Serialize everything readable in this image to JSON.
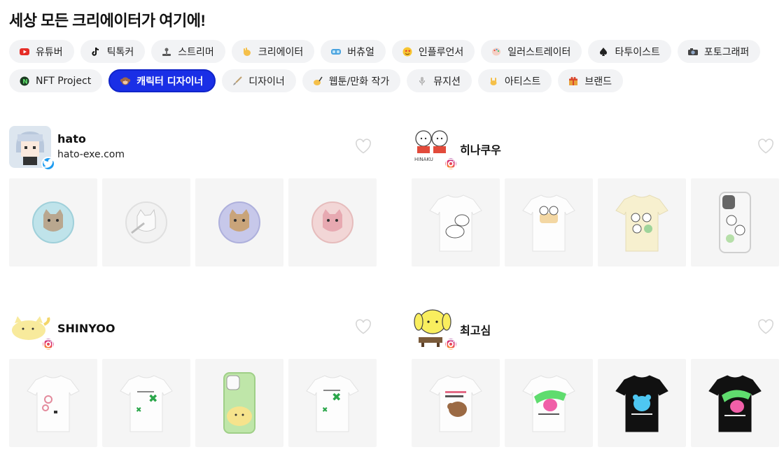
{
  "page": {
    "title": "세상 모든 크리에이터가 여기에!"
  },
  "categories": {
    "row1": [
      {
        "label": "유튜버",
        "icon": "youtube-icon"
      },
      {
        "label": "틱톡커",
        "icon": "tiktok-icon"
      },
      {
        "label": "스트리머",
        "icon": "joystick-icon"
      },
      {
        "label": "크리에이터",
        "icon": "hand-icon"
      },
      {
        "label": "버츄얼",
        "icon": "vr-goggles-icon"
      },
      {
        "label": "인플루언서",
        "icon": "star-eyes-icon"
      },
      {
        "label": "일러스트레이터",
        "icon": "palette-icon"
      },
      {
        "label": "타투이스트",
        "icon": "spade-icon"
      },
      {
        "label": "포토그래퍼",
        "icon": "camera-icon"
      }
    ],
    "row2": [
      {
        "label": "NFT Project",
        "icon": "nft-icon"
      },
      {
        "label": "캐릭터 디자이너",
        "icon": "monkey-icon",
        "active": true
      },
      {
        "label": "디자이너",
        "icon": "brush-icon"
      },
      {
        "label": "웹툰/만화 작가",
        "icon": "writing-hand-icon"
      },
      {
        "label": "뮤지션",
        "icon": "microphone-icon"
      },
      {
        "label": "아티스트",
        "icon": "rock-hand-icon"
      },
      {
        "label": "브랜드",
        "icon": "gift-icon"
      }
    ]
  },
  "creators": [
    {
      "name": "hato",
      "subtitle": "hato-exe.com",
      "social": "twitter-icon"
    },
    {
      "name": "히나쿠우",
      "subtitle": "",
      "social": "instagram-icon"
    },
    {
      "name": "SHINYOO",
      "subtitle": "",
      "social": "instagram-icon"
    },
    {
      "name": "최고심",
      "subtitle": "",
      "social": "instagram-icon"
    }
  ],
  "colors": {
    "active_chip": "#1a2fe6",
    "chip_bg": "#f2f3f5",
    "thumb_bg": "#f5f5f5"
  }
}
